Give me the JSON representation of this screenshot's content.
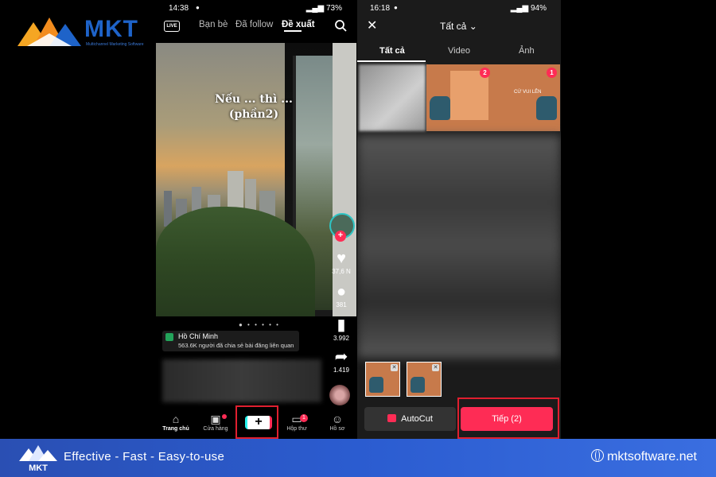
{
  "brand": {
    "logo_text": "MKT",
    "logo_sub": "Multichannel Marketing Software",
    "slogan": "Effective - Fast - Easy-to-use",
    "website": "mktsoftware.net",
    "accent_color": "#1e63c9"
  },
  "phone1": {
    "status": {
      "time": "14:38",
      "battery": "73%"
    },
    "top_nav": {
      "live_label": "LIVE",
      "tabs": [
        "Bạn bè",
        "Đã follow",
        "Đề xuất"
      ],
      "active_tab": "Đề xuất"
    },
    "video_caption": "Nếu ... thì ...\n(phần2)",
    "actions": {
      "likes": "37,6 N",
      "comments": "381",
      "saves": "3.992",
      "shares": "1.419"
    },
    "location": {
      "name": "Hồ Chí Minh",
      "subtitle": "563.6K người đã chia sẻ bài đăng liên quan"
    },
    "bottom_nav": {
      "home": "Trang chủ",
      "shop": "Cửa hàng",
      "inbox": "Hộp thư",
      "profile": "Hồ sơ",
      "inbox_badge": "1"
    }
  },
  "phone2": {
    "status": {
      "time": "16:18",
      "battery": "94%"
    },
    "album_title": "Tất cả",
    "tabs": [
      "Tất cả",
      "Video",
      "Ảnh"
    ],
    "active_tab": "Tất cả",
    "thumbs": [
      {
        "selection": ""
      },
      {
        "selection": "2"
      },
      {
        "selection": "1",
        "caption": "CỨ VUI LÊN"
      }
    ],
    "autocut_label": "AutoCut",
    "next_label": "Tiếp (2)",
    "next_color": "#fe2c55"
  }
}
